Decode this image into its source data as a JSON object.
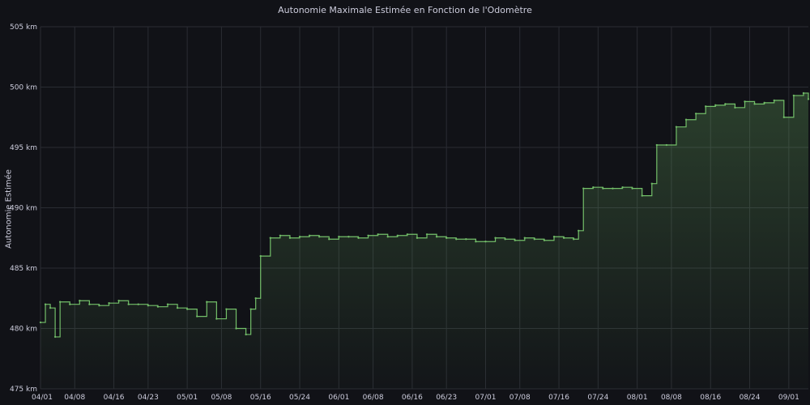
{
  "chart_data": {
    "type": "line",
    "title": "Autonomie Maximale Estimée en Fonction de l'Odomètre",
    "xlabel": "",
    "ylabel": "Autonomie Estimée",
    "y_unit": "km",
    "ylim": [
      475,
      505
    ],
    "yticks": [
      475,
      480,
      485,
      490,
      495,
      500,
      505
    ],
    "ytick_labels": [
      "475 km",
      "480 km",
      "485 km",
      "490 km",
      "495 km",
      "500 km",
      "505 km"
    ],
    "xtick_labels": [
      "04/01",
      "04/08",
      "04/16",
      "04/23",
      "05/01",
      "05/08",
      "05/16",
      "05/24",
      "06/01",
      "06/08",
      "06/16",
      "06/23",
      "07/01",
      "07/08",
      "07/16",
      "07/24",
      "08/01",
      "08/08",
      "08/16",
      "08/24",
      "09/01"
    ],
    "grid": true,
    "line_color": "#73bf69",
    "series": [
      {
        "x": [
          "04/01",
          "04/02",
          "04/03",
          "04/04",
          "04/05",
          "04/07",
          "04/09",
          "04/11",
          "04/13",
          "04/15",
          "04/17",
          "04/19",
          "04/21",
          "04/23",
          "04/25",
          "04/27",
          "04/29",
          "05/01",
          "05/03",
          "05/05",
          "05/07",
          "05/09",
          "05/11",
          "05/13",
          "05/14",
          "05/15",
          "05/16",
          "05/18",
          "05/20",
          "05/22",
          "05/24",
          "05/26",
          "05/28",
          "05/30",
          "06/01",
          "06/03",
          "06/05",
          "06/07",
          "06/09",
          "06/11",
          "06/13",
          "06/15",
          "06/17",
          "06/19",
          "06/21",
          "06/23",
          "06/25",
          "06/27",
          "06/29",
          "07/01",
          "07/03",
          "07/05",
          "07/07",
          "07/09",
          "07/11",
          "07/13",
          "07/15",
          "07/17",
          "07/19",
          "07/20",
          "07/21",
          "07/23",
          "07/25",
          "07/27",
          "07/29",
          "07/31",
          "08/02",
          "08/04",
          "08/05",
          "08/07",
          "08/09",
          "08/11",
          "08/13",
          "08/15",
          "08/17",
          "08/19",
          "08/21",
          "08/23",
          "08/25",
          "08/27",
          "08/29",
          "08/31",
          "09/02",
          "09/04",
          "09/05"
        ],
        "values": [
          480.5,
          482,
          481.7,
          479.3,
          482.2,
          482,
          482.3,
          482,
          481.9,
          482.1,
          482.3,
          482,
          482,
          481.9,
          481.8,
          482,
          481.7,
          481.6,
          481,
          482.2,
          480.8,
          481.6,
          480,
          479.5,
          481.6,
          482.5,
          486,
          487.5,
          487.7,
          487.5,
          487.6,
          487.7,
          487.6,
          487.4,
          487.6,
          487.6,
          487.5,
          487.7,
          487.8,
          487.6,
          487.7,
          487.8,
          487.5,
          487.8,
          487.6,
          487.5,
          487.4,
          487.4,
          487.2,
          487.2,
          487.5,
          487.4,
          487.3,
          487.5,
          487.4,
          487.3,
          487.6,
          487.5,
          487.4,
          488.1,
          491.6,
          491.7,
          491.6,
          491.6,
          491.7,
          491.6,
          491,
          492,
          495.2,
          495.2,
          496.7,
          497.3,
          497.8,
          498.4,
          498.5,
          498.6,
          498.3,
          498.8,
          498.6,
          498.7,
          498.9,
          497.5,
          499.3,
          499.5,
          499
        ]
      }
    ]
  }
}
